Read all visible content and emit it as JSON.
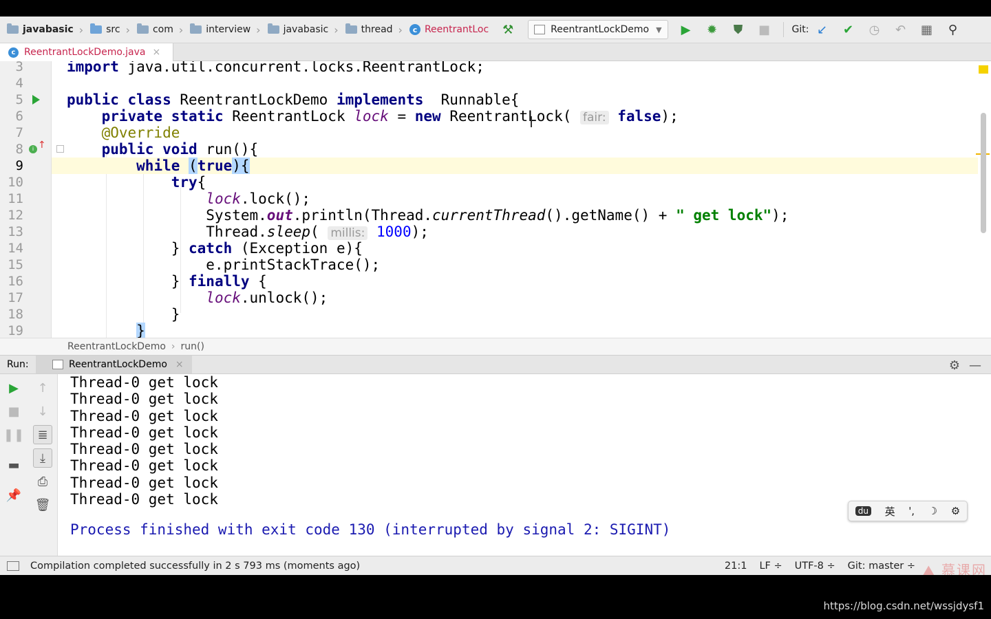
{
  "navbar": {
    "crumbs": [
      "javabasic",
      "src",
      "com",
      "interview",
      "javabasic",
      "thread",
      "ReentrantLoc"
    ],
    "run_config": "ReentrantLockDemo",
    "git_label": "Git:"
  },
  "editor": {
    "tab_label": "ReentrantLockDemo.java",
    "line_numbers": [
      "3",
      "4",
      "5",
      "6",
      "7",
      "8",
      "9",
      "10",
      "11",
      "12",
      "13",
      "14",
      "15",
      "16",
      "17",
      "18",
      "19"
    ],
    "hint_fair": "fair:",
    "hint_millis": "millis:",
    "breadcrumb": [
      "ReentrantLockDemo",
      "run()"
    ]
  },
  "run_panel": {
    "title": "Run:",
    "tab_label": "ReentrantLockDemo",
    "output_lines": [
      "Thread-0 get lock",
      "Thread-0 get lock",
      "Thread-0 get lock",
      "Thread-0 get lock",
      "Thread-0 get lock",
      "Thread-0 get lock",
      "Thread-0 get lock",
      "Thread-0 get lock"
    ],
    "exit_message": "Process finished with exit code 130 (interrupted by signal 2: SIGINT)"
  },
  "ime": {
    "lang": "英",
    "punct": "',"
  },
  "status": {
    "message": "Compilation completed successfully in 2 s 793 ms (moments ago)",
    "position": "21:1",
    "line_sep": "LF ÷",
    "encoding": "UTF-8 ÷",
    "vcs": "Git: master ÷"
  },
  "overlay": {
    "url": "https://blog.csdn.net/wssjdysf1",
    "logo": "慕课网"
  }
}
